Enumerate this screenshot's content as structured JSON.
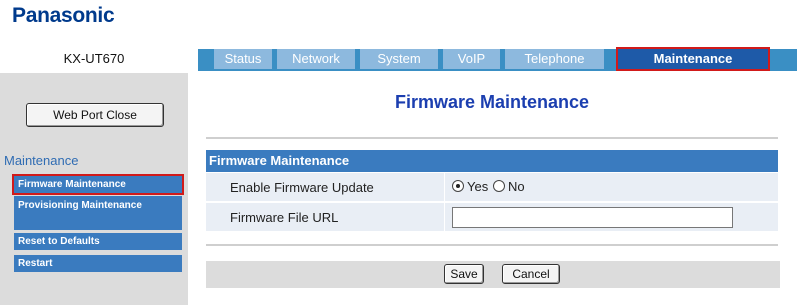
{
  "brand": {
    "logo_text": "Panasonic"
  },
  "device": {
    "model": "KX-UT670"
  },
  "tabs": [
    {
      "label": "Status"
    },
    {
      "label": "Network"
    },
    {
      "label": "System"
    },
    {
      "label": "VoIP"
    },
    {
      "label": "Telephone"
    },
    {
      "label": "Maintenance",
      "active": true
    }
  ],
  "sidebar": {
    "web_port_button": "Web Port Close",
    "heading": "Maintenance",
    "items": [
      {
        "label": "Firmware Maintenance",
        "active": true
      },
      {
        "label": "Provisioning Maintenance"
      },
      {
        "label": "Reset to Defaults"
      },
      {
        "label": "Restart"
      }
    ]
  },
  "page": {
    "title": "Firmware Maintenance",
    "section_title": "Firmware Maintenance",
    "fields": {
      "enable_update": {
        "label": "Enable Firmware Update",
        "options": [
          "Yes",
          "No"
        ],
        "selected": "Yes"
      },
      "file_url": {
        "label": "Firmware File URL",
        "value": ""
      }
    }
  },
  "actions": {
    "save": "Save",
    "cancel": "Cancel"
  },
  "colors": {
    "brand": "#003a8c",
    "tab_active": "#1e5aa8",
    "tab_inactive": "#8db9de",
    "section_header": "#3a7bbf",
    "highlight_border": "#d11a1a",
    "title": "#1c3fb0"
  }
}
